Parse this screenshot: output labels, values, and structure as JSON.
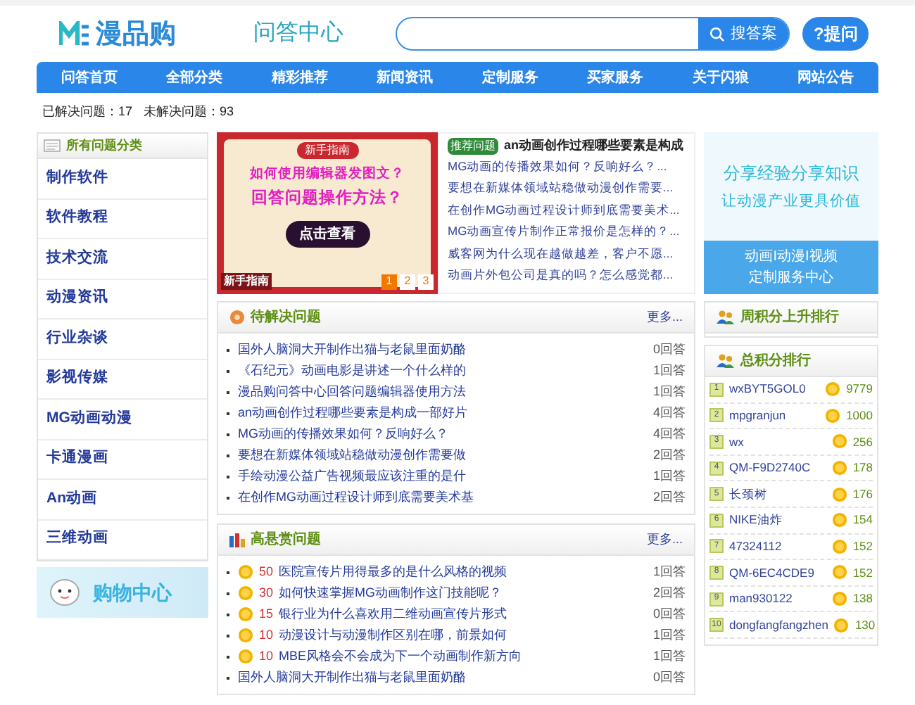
{
  "header": {
    "logo_text": "漫品购",
    "section_title": "问答中心",
    "search_button": "搜答案",
    "ask_button": "?提问"
  },
  "nav": [
    "问答首页",
    "全部分类",
    "精彩推荐",
    "新闻资讯",
    "定制服务",
    "买家服务",
    "关于闪狼",
    "网站公告"
  ],
  "stats": [
    "已解决问题：17",
    "未解决问题：93"
  ],
  "sidebar": {
    "title": "所有问题分类",
    "items": [
      "制作软件",
      "软件教程",
      "技术交流",
      "动漫资讯",
      "行业杂谈",
      "影视传媒",
      "MG动画动漫",
      "卡通漫画",
      "An动画",
      "三维动画"
    ]
  },
  "shop_banner": "购物中心",
  "banner": {
    "badge": "新手指南",
    "lines": [
      "如何使用编辑器发图文？",
      "回答问题操作方法？"
    ],
    "button": "点击查看",
    "caption": "新手指南",
    "pages": [
      {
        "label": "1",
        "selected": true
      },
      {
        "label": "2",
        "selected": false
      },
      {
        "label": "3",
        "selected": false
      }
    ]
  },
  "recommend": {
    "tag": "推荐问题",
    "title": "an动画创作过程哪些要素是构成",
    "links": [
      "MG动画的传播效果如何？反响好么？...",
      "要想在新媒体领域站稳做动漫创作需要...",
      "在创作MG动画过程设计师到底需要美术...",
      "MG动画宣传片制作正常报价是怎样的？...",
      "威客网为什么现在越做越差，客户不愿...",
      "动画片外包公司是真的吗？怎么感觉都..."
    ]
  },
  "ad": {
    "lines": [
      "分享经验分享知识",
      "让动漫产业更具价值"
    ],
    "lines_bottom": [
      "动画I动漫I视频",
      "定制服务中心"
    ]
  },
  "pending": {
    "title": "待解决问题",
    "more": "更多...",
    "rows": [
      {
        "title": "国外人脑洞大开制作出猫与老鼠里面奶酪",
        "answers": "0回答"
      },
      {
        "title": "《石纪元》动画电影是讲述一个什么样的",
        "answers": "1回答"
      },
      {
        "title": "漫品购问答中心回答问题编辑器使用方法",
        "answers": "1回答"
      },
      {
        "title": "an动画创作过程哪些要素是构成一部好片",
        "answers": "4回答"
      },
      {
        "title": "MG动画的传播效果如何？反响好么？",
        "answers": "4回答"
      },
      {
        "title": "要想在新媒体领域站稳做动漫创作需要做",
        "answers": "2回答"
      },
      {
        "title": "手绘动漫公益广告视频最应该注重的是什",
        "answers": "1回答"
      },
      {
        "title": "在创作MG动画过程设计师到底需要美术基",
        "answers": "2回答"
      }
    ]
  },
  "bounty": {
    "title": "高悬赏问题",
    "more": "更多...",
    "rows": [
      {
        "kind": "reward",
        "reward": "50",
        "title": "医院宣传片用得最多的是什么风格的视频",
        "answers": "1回答"
      },
      {
        "kind": "reward",
        "reward": "30",
        "title": "如何快速掌握MG动画制作这门技能呢？",
        "answers": "2回答"
      },
      {
        "kind": "reward",
        "reward": "15",
        "title": "银行业为什么喜欢用二维动画宣传片形式",
        "answers": "0回答"
      },
      {
        "kind": "reward",
        "reward": "10",
        "title": "动漫设计与动漫制作区别在哪，前景如何",
        "answers": "1回答"
      },
      {
        "kind": "reward",
        "reward": "10",
        "title": "MBE风格会不会成为下一个动画制作新方向",
        "answers": "1回答"
      },
      {
        "kind": "plain",
        "title": "国外人脑洞大开制作出猫与老鼠里面奶酪",
        "answers": "0回答"
      }
    ]
  },
  "week_rank": {
    "title": "周积分上升排行"
  },
  "total_rank": {
    "title": "总积分排行",
    "rows": [
      {
        "rank": "1",
        "name": "wxBYT5GOL0",
        "points": "9779"
      },
      {
        "rank": "2",
        "name": "mpgranjun",
        "points": "1000"
      },
      {
        "rank": "3",
        "name": "wx",
        "points": "256"
      },
      {
        "rank": "4",
        "name": "QM-F9D2740C",
        "points": "178"
      },
      {
        "rank": "5",
        "name": "长颈树",
        "points": "176"
      },
      {
        "rank": "6",
        "name": "NIKE油炸",
        "points": "154"
      },
      {
        "rank": "7",
        "name": "47324112",
        "points": "152"
      },
      {
        "rank": "8",
        "name": "QM-6EC4CDE9",
        "points": "152"
      },
      {
        "rank": "9",
        "name": "man930122",
        "points": "138"
      },
      {
        "rank": "10",
        "name": "dongfangfangzhen",
        "points": "130"
      }
    ]
  }
}
